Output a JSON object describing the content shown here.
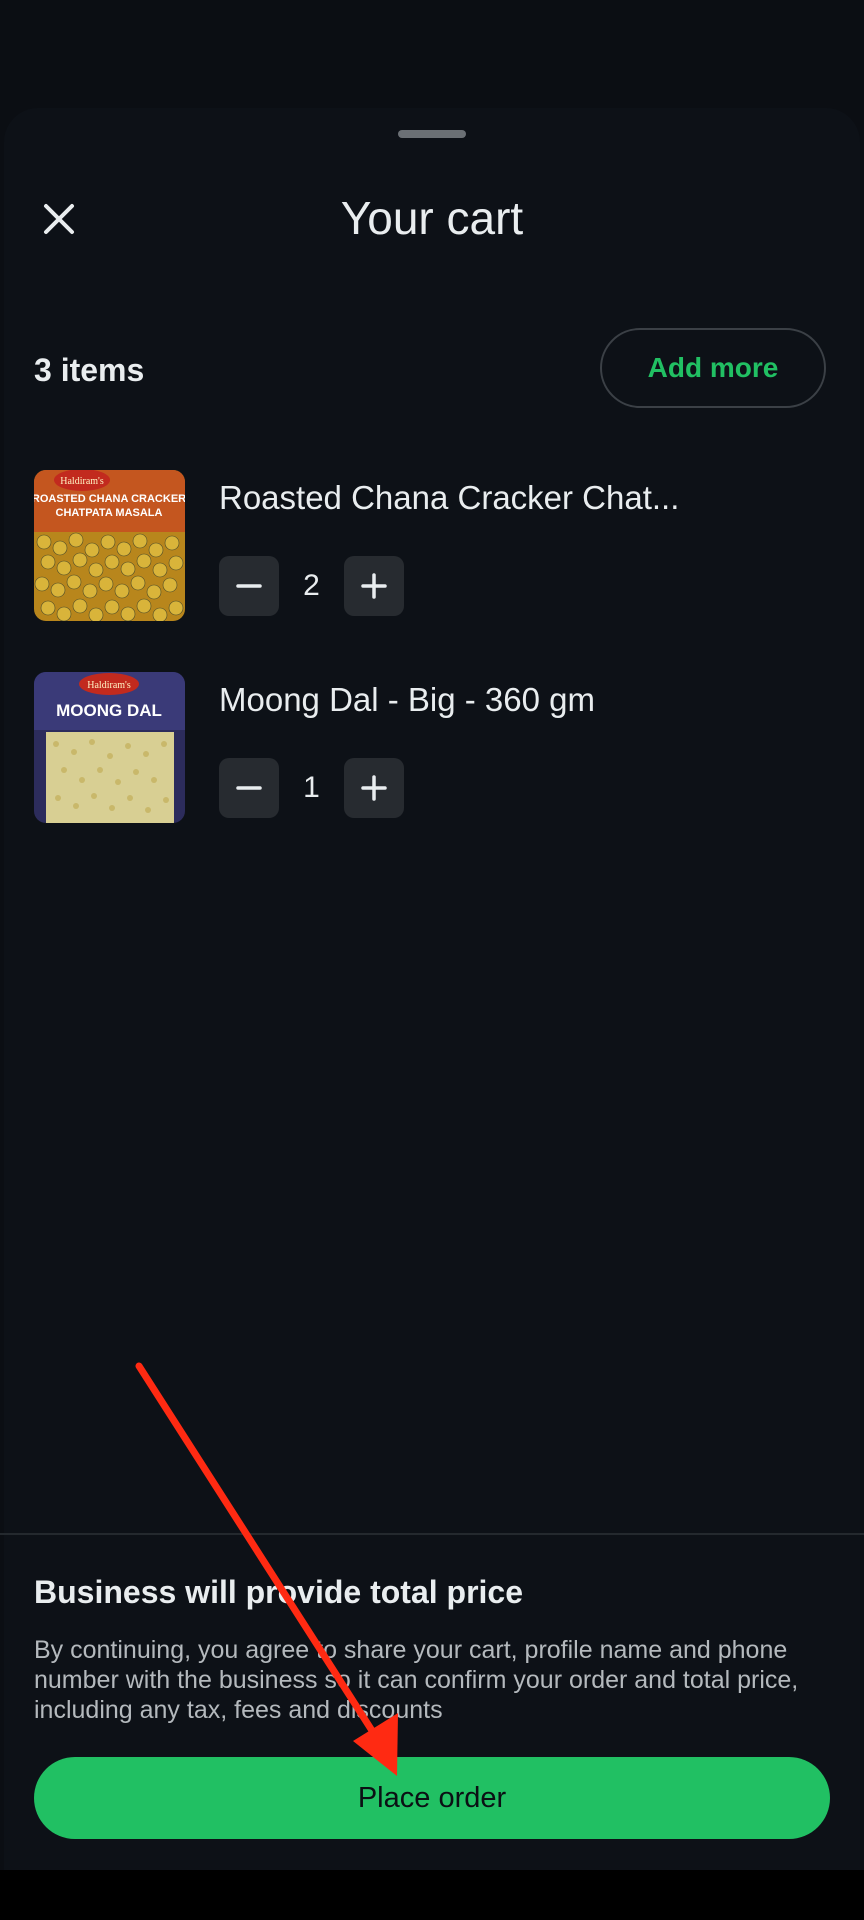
{
  "header": {
    "title": "Your cart",
    "close_icon": "close-icon"
  },
  "cart": {
    "items_count_label": "3 items",
    "add_more_label": "Add more",
    "items": [
      {
        "name": "Roasted Chana Cracker Chat...",
        "quantity": "2",
        "thumb_brand": "Haldiram's",
        "thumb_lines": [
          "ROASTED CHANA CRACKER",
          "CHATPATA MASALA"
        ]
      },
      {
        "name": "Moong Dal - Big - 360 gm",
        "quantity": "1",
        "thumb_brand": "Haldiram's",
        "thumb_lines": [
          "MOONG DAL"
        ]
      }
    ]
  },
  "footer": {
    "title": "Business will provide total price",
    "disclaimer": "By continuing, you agree to share your cart, profile name and phone number with the business so it can confirm your order and total price, including any tax, fees and discounts",
    "place_order_label": "Place order"
  },
  "colors": {
    "accent": "#21c063",
    "background": "#0d1117",
    "annotation_arrow": "#ff2a12"
  }
}
